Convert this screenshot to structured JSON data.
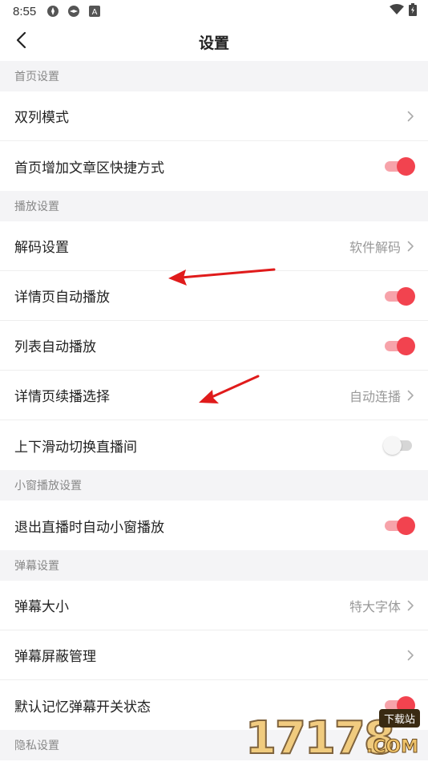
{
  "status_bar": {
    "time": "8:55",
    "left_icons": [
      "app-icon-1",
      "app-icon-2",
      "font-a-icon"
    ],
    "right_icons": [
      "wifi-icon",
      "battery-icon"
    ]
  },
  "header": {
    "title": "设置",
    "back_icon": "chevron-left-icon"
  },
  "sections": [
    {
      "title": "首页设置",
      "rows": [
        {
          "label": "双列模式",
          "type": "nav",
          "value": ""
        },
        {
          "label": "首页增加文章区快捷方式",
          "type": "toggle",
          "on": true
        }
      ]
    },
    {
      "title": "播放设置",
      "rows": [
        {
          "label": "解码设置",
          "type": "nav",
          "value": "软件解码"
        },
        {
          "label": "详情页自动播放",
          "type": "toggle",
          "on": true
        },
        {
          "label": "列表自动播放",
          "type": "toggle",
          "on": true
        },
        {
          "label": "详情页续播选择",
          "type": "nav",
          "value": "自动连播"
        },
        {
          "label": "上下滑动切换直播间",
          "type": "toggle",
          "on": false
        }
      ]
    },
    {
      "title": "小窗播放设置",
      "rows": [
        {
          "label": "退出直播时自动小窗播放",
          "type": "toggle",
          "on": true
        }
      ]
    },
    {
      "title": "弹幕设置",
      "rows": [
        {
          "label": "弹幕大小",
          "type": "nav",
          "value": "特大字体"
        },
        {
          "label": "弹幕屏蔽管理",
          "type": "nav",
          "value": ""
        },
        {
          "label": "默认记忆弹幕开关状态",
          "type": "toggle",
          "on": true
        }
      ]
    },
    {
      "title": "隐私设置",
      "rows": []
    }
  ],
  "colors": {
    "accent": "#f2434f",
    "accent_track": "#f7a3aa",
    "section_bg": "#f4f4f6",
    "annotation_arrow": "#e01b1b"
  },
  "watermark": {
    "text": "17178",
    "badge": "下载站",
    "suffix": ".COM"
  }
}
